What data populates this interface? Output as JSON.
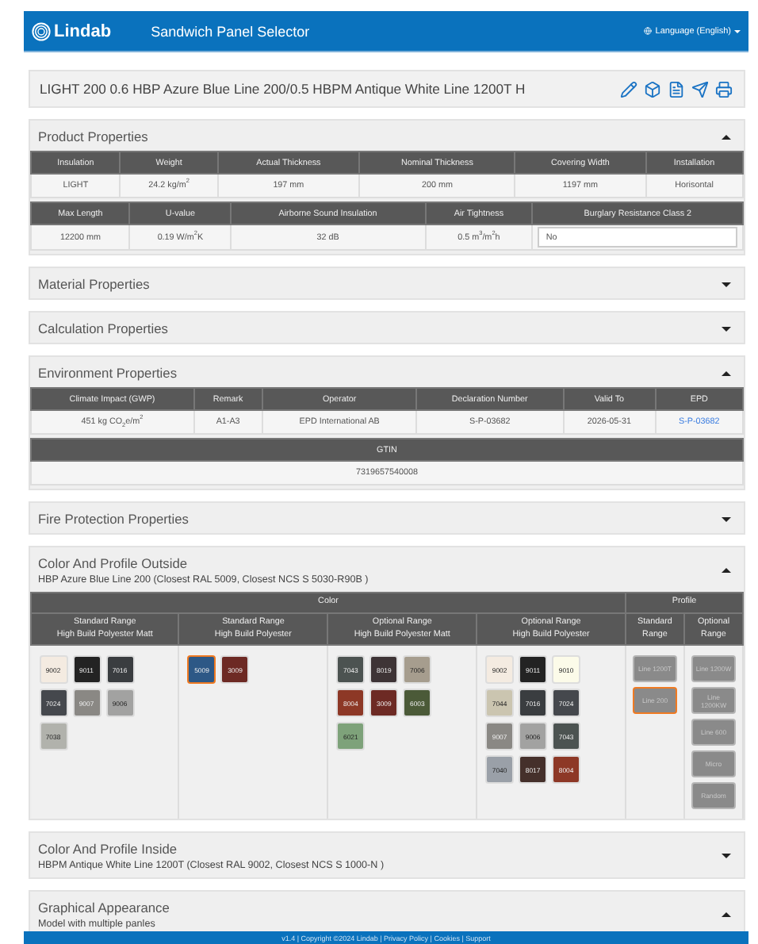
{
  "header": {
    "brand": "Lindab",
    "title": "Sandwich Panel Selector",
    "language": "Language (English)"
  },
  "product_title": "LIGHT 200 0.6 HBP Azure Blue Line 200/0.5 HBPM Antique White Line 1200T H",
  "sections": [
    {
      "kind": "tables",
      "title": "Product Properties",
      "expanded": true,
      "tables": [
        {
          "columns": [
            "Insulation",
            "Weight",
            "Actual Thickness",
            "Nominal Thickness",
            "Covering Width",
            "Installation"
          ],
          "cells": [
            {
              "text": "LIGHT",
              "kind": "text"
            },
            {
              "text": "24.2 kg/m$^{2}$",
              "kind": "text"
            },
            {
              "text": "197 mm",
              "kind": "text"
            },
            {
              "text": "200 mm",
              "kind": "text"
            },
            {
              "text": "1197 mm",
              "kind": "text"
            },
            {
              "text": "Horisontal",
              "kind": "text"
            }
          ]
        },
        {
          "columns": [
            "Max Length",
            "U-value",
            "Airborne Sound Insulation",
            "Air Tightness",
            "Burglary Resistance Class 2"
          ],
          "cells": [
            {
              "text": "12200 mm",
              "kind": "text"
            },
            {
              "text": "0.19 W/m$^{2}$K",
              "kind": "text"
            },
            {
              "text": "32 dB",
              "kind": "text"
            },
            {
              "text": "0.5 m$^{3}$/m$^{2}$h",
              "kind": "text"
            },
            {
              "text": "No",
              "kind": "field"
            }
          ]
        }
      ]
    },
    {
      "kind": "plain",
      "title": "Material Properties",
      "expanded": false
    },
    {
      "kind": "plain",
      "title": "Calculation Properties",
      "expanded": false
    },
    {
      "kind": "tables",
      "title": "Environment Properties",
      "expanded": true,
      "tables": [
        {
          "columns": [
            "Climate Impact (GWP)",
            "Remark",
            "Operator",
            "Declaration Number",
            "Valid To",
            "EPD"
          ],
          "cells": [
            {
              "text": "451 kg CO$_{2}$e/m$^{2}$",
              "kind": "text"
            },
            {
              "text": "A1-A3",
              "kind": "text"
            },
            {
              "text": "EPD International AB",
              "kind": "text"
            },
            {
              "text": "S-P-03682",
              "kind": "text"
            },
            {
              "text": "2026-05-31",
              "kind": "text"
            },
            {
              "text": "S-P-03682",
              "kind": "link"
            }
          ]
        },
        {
          "columns": [
            "GTIN"
          ],
          "cells": [
            {
              "text": "7319657540008",
              "kind": "text"
            }
          ]
        }
      ]
    },
    {
      "kind": "plain",
      "title": "Fire Protection Properties",
      "expanded": false
    },
    {
      "kind": "colors",
      "title": "Color And Profile Outside",
      "subtitle": "HBP Azure Blue Line 200 (Closest RAL 5009, Closest NCS S 5030-R90B )",
      "expanded": true,
      "color_label": "Color",
      "profile_label": "Profile",
      "color_groups": [
        {
          "heading": [
            "Standard Range",
            "High Build Polyester Matt"
          ],
          "swatches": [
            {
              "label": "9002",
              "color": "#f4ebe1",
              "selected": false
            },
            {
              "label": "9011",
              "color": "#232323",
              "selected": false
            },
            {
              "label": "7016",
              "color": "#3a3d40",
              "selected": false
            },
            {
              "label": "7024",
              "color": "#45484d",
              "selected": false
            },
            {
              "label": "9007",
              "color": "#8a8884",
              "selected": false
            },
            {
              "label": "9006",
              "color": "#a2a2a1",
              "selected": false
            },
            {
              "label": "7038",
              "color": "#b1b2ac",
              "selected": false
            }
          ]
        },
        {
          "heading": [
            "Standard Range",
            "High Build Polyester"
          ],
          "swatches": [
            {
              "label": "5009",
              "color": "#2d5886",
              "selected": true
            },
            {
              "label": "3009",
              "color": "#6d2a24",
              "selected": false
            }
          ]
        },
        {
          "heading": [
            "Optional Range",
            "High Build Polyester Matt"
          ],
          "swatches": [
            {
              "label": "7043",
              "color": "#4c5351",
              "selected": false
            },
            {
              "label": "8019",
              "color": "#3e3436",
              "selected": false
            },
            {
              "label": "7006",
              "color": "#a69d8e",
              "selected": false
            },
            {
              "label": "8004",
              "color": "#8d3826",
              "selected": false
            },
            {
              "label": "3009",
              "color": "#6d2a24",
              "selected": false
            },
            {
              "label": "6003",
              "color": "#4b5a38",
              "selected": false
            },
            {
              "label": "6021",
              "color": "#7ea27a",
              "selected": false
            }
          ]
        },
        {
          "heading": [
            "Optional Range",
            "High Build Polyester"
          ],
          "swatches": [
            {
              "label": "9002",
              "color": "#f4ebe1",
              "selected": false
            },
            {
              "label": "9011",
              "color": "#232323",
              "selected": false
            },
            {
              "label": "9010",
              "color": "#fcfbe9",
              "selected": false
            },
            {
              "label": "7044",
              "color": "#cbc5b0",
              "selected": false
            },
            {
              "label": "7016",
              "color": "#3a3d40",
              "selected": false
            },
            {
              "label": "7024",
              "color": "#45484d",
              "selected": false
            },
            {
              "label": "9007",
              "color": "#8a8884",
              "selected": false
            },
            {
              "label": "9006",
              "color": "#a2a2a1",
              "selected": false
            },
            {
              "label": "7043",
              "color": "#4c5351",
              "selected": false
            },
            {
              "label": "7040",
              "color": "#9aa0a8",
              "selected": false
            },
            {
              "label": "8017",
              "color": "#45302b",
              "selected": false
            },
            {
              "label": "8004",
              "color": "#8d3826",
              "selected": false
            }
          ]
        }
      ],
      "profile_groups": [
        {
          "heading": [
            "Standard",
            "Range"
          ],
          "profiles": [
            {
              "label": "Line 1200T",
              "selected": false
            },
            {
              "label": "Line 200",
              "selected": true
            }
          ]
        },
        {
          "heading": [
            "Optional",
            "Range"
          ],
          "profiles": [
            {
              "label": "Line 1200W",
              "selected": false
            },
            {
              "label": "Line 1200KW",
              "selected": false
            },
            {
              "label": "Line 600",
              "selected": false
            },
            {
              "label": "Micro",
              "selected": false
            },
            {
              "label": "Random",
              "selected": false
            }
          ]
        }
      ]
    },
    {
      "kind": "subtitle",
      "title": "Color And Profile Inside",
      "subtitle": "HBPM Antique White Line 1200T (Closest RAL 9002, Closest NCS S 1000-N )",
      "expanded": false
    },
    {
      "kind": "subtitle",
      "title": "Graphical Appearance",
      "subtitle": "Model with multiple panles",
      "expanded": true
    }
  ],
  "footer": "v1.4 | Copyright ©2024 Lindab | Privacy Policy | Cookies | Support"
}
